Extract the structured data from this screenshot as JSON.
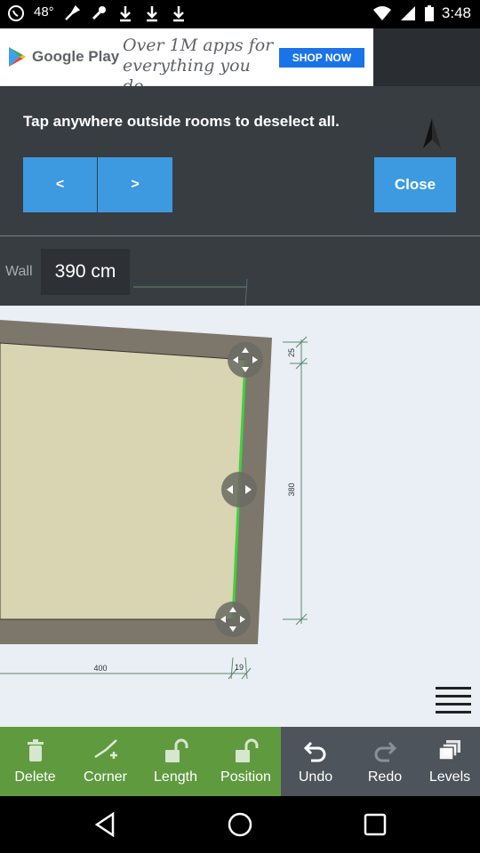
{
  "status_bar": {
    "time": "3:48",
    "left_icons": [
      "whatsapp-icon",
      "temperature-icon",
      "tools-icon",
      "wrench-icon",
      "download-icon",
      "download-icon",
      "download-icon"
    ],
    "temperature": "48°"
  },
  "ad": {
    "brand": "Google Play",
    "text": "Over 1M apps for everything you do.",
    "cta": "SHOP NOW"
  },
  "panel": {
    "instruction": "Tap anywhere outside rooms to deselect all.",
    "prev_label": "<",
    "next_label": ">",
    "close_label": "Close",
    "wall_label": "Wall",
    "wall_value": "390 cm"
  },
  "canvas": {
    "dim_bottom": "400",
    "dim_bottom_right": "19",
    "dim_right_top": "25",
    "dim_right": "380"
  },
  "toolbar": {
    "items": [
      {
        "label": "Delete",
        "icon": "trash-icon"
      },
      {
        "label": "Corner",
        "icon": "corner-add-icon"
      },
      {
        "label": "Length",
        "icon": "unlock-icon"
      },
      {
        "label": "Position",
        "icon": "unlock-icon"
      },
      {
        "label": "Undo",
        "icon": "undo-icon"
      },
      {
        "label": "Redo",
        "icon": "redo-icon"
      },
      {
        "label": "Levels",
        "icon": "levels-icon"
      }
    ]
  },
  "colors": {
    "accent_blue": "#3d9ae0",
    "toolbar_green": "#5f9a3f",
    "toolbar_gray": "#4d545b",
    "selected_wall": "#3fd13f"
  }
}
